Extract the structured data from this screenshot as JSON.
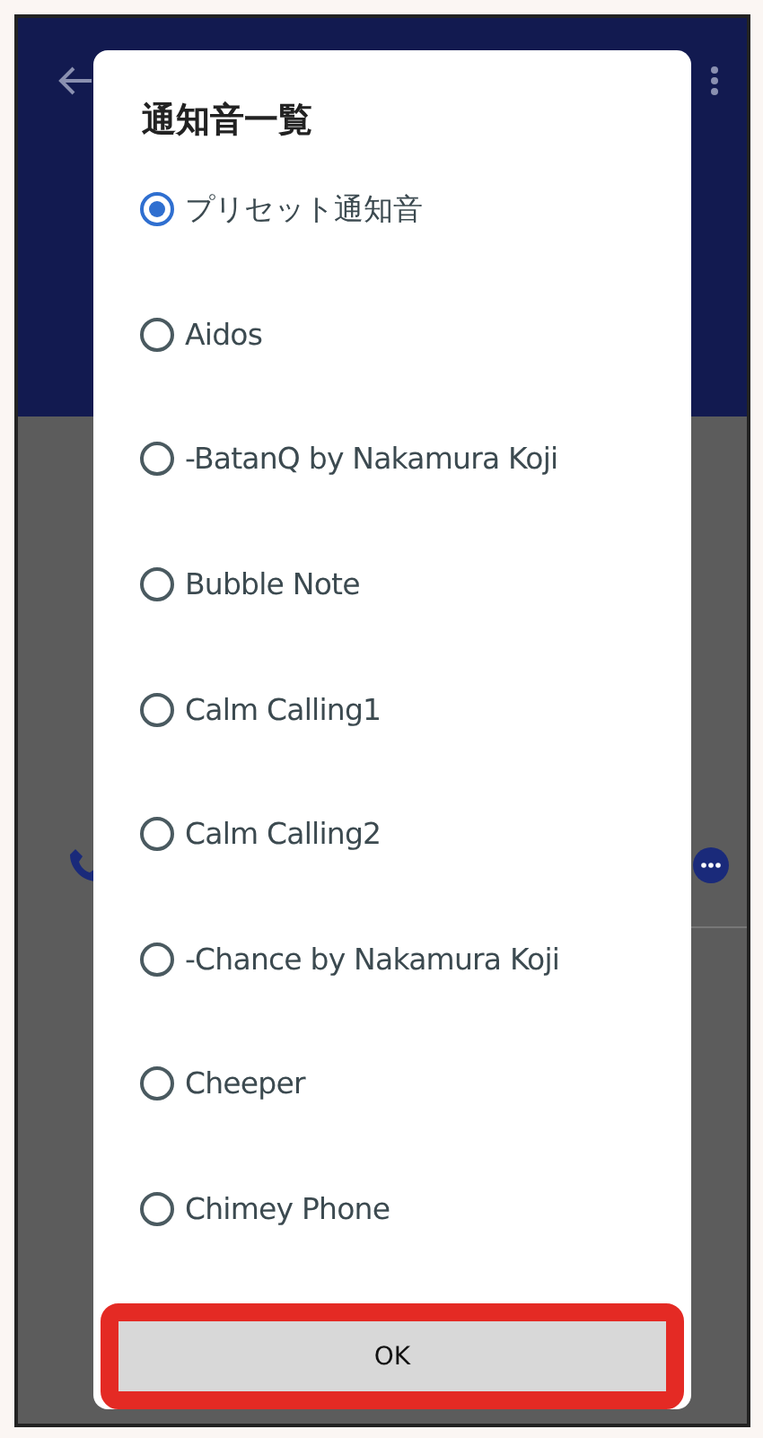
{
  "dialog": {
    "title": "通知音一覧",
    "options": [
      {
        "label": "プリセット通知音",
        "selected": true
      },
      {
        "label": "Aidos",
        "selected": false
      },
      {
        "label": "-BatanQ by Nakamura Koji",
        "selected": false
      },
      {
        "label": "Bubble Note",
        "selected": false
      },
      {
        "label": "Calm Calling1",
        "selected": false
      },
      {
        "label": "Calm Calling2",
        "selected": false
      },
      {
        "label": "-Chance by Nakamura Koji",
        "selected": false
      },
      {
        "label": "Cheeper",
        "selected": false
      },
      {
        "label": "Chimey Phone",
        "selected": false
      }
    ],
    "button": "OK"
  }
}
